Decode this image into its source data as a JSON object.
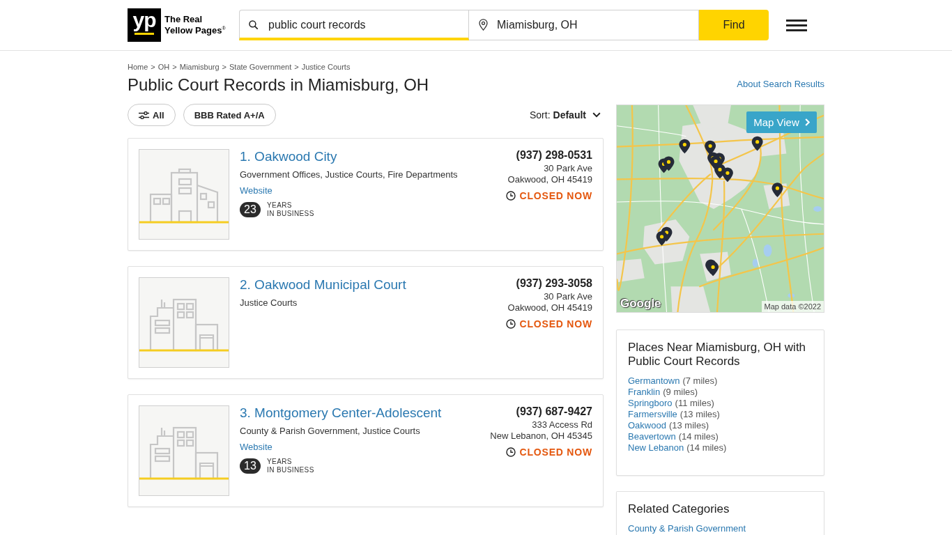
{
  "header": {
    "logo": {
      "mark": "yp",
      "name": "The Real Yellow Pages$^{®}$"
    },
    "search": {
      "value": "public court records"
    },
    "location": {
      "value": "Miamisburg, OH"
    },
    "find_button": "Find"
  },
  "breadcrumb": [
    {
      "label": "Home",
      "separator": ">"
    },
    {
      "label": "OH",
      "separator": ">"
    },
    {
      "label": "Miamisburg",
      "separator": ">"
    },
    {
      "label": "State Government",
      "separator": ">"
    },
    {
      "label": "Justice Courts"
    }
  ],
  "title": "Public Court Records in Miamisburg, OH",
  "about_link": "About Search Results",
  "filters": [
    {
      "label": "All",
      "kind": "menu"
    },
    {
      "label": "BBB Rated A+/A",
      "kind": "toggle"
    }
  ],
  "sort": {
    "label": "Sort:",
    "value": "Default"
  },
  "listings": [
    {
      "kind": "low-rise",
      "title": "1. Oakwood City",
      "categories": "Government Offices, Justice Courts, Fire Departments",
      "website": "Website",
      "years": "23",
      "years_label": [
        "YEARS",
        "IN BUSINESS"
      ],
      "phone": "(937) 298-0531",
      "address": [
        "30 Park Ave",
        "Oakwood, OH 45419"
      ],
      "status": "CLOSED NOW",
      "open": false
    },
    {
      "kind": "high-rise",
      "title": "2. Oakwood Municipal Court",
      "categories": "Justice Courts",
      "phone": "(937) 293-3058",
      "address": [
        "30 Park Ave",
        "Oakwood, OH 45419"
      ],
      "status": "CLOSED NOW",
      "open": false
    },
    {
      "kind": "high-rise",
      "title": "3. Montgomery Center-Adolescent",
      "categories": "County & Parish Government, Justice Courts",
      "website": "Website",
      "years": "13",
      "years_label": [
        "YEARS",
        "IN BUSINESS"
      ],
      "phone": "(937) 687-9427",
      "address": [
        "333 Access Rd",
        "New Lebanon, OH 45345"
      ],
      "status": "CLOSED NOW",
      "open": false
    }
  ],
  "map": {
    "button": "Map View",
    "logo": "Google",
    "attribution": "Map data ©2022"
  },
  "places_near": {
    "title": "Places Near Miamisburg, OH with Public Court Records",
    "items": [
      {
        "name": "Germantown",
        "distance": "(7 miles)"
      },
      {
        "name": "Franklin",
        "distance": "(9 miles)"
      },
      {
        "name": "Springboro",
        "distance": "(11 miles)"
      },
      {
        "name": "Farmersville",
        "distance": "(13 miles)"
      },
      {
        "name": "Oakwood",
        "distance": "(13 miles)"
      },
      {
        "name": "Beavertown",
        "distance": "(14 miles)"
      },
      {
        "name": "New Lebanon",
        "distance": "(14 miles)"
      }
    ]
  },
  "related_categories": {
    "title": "Related Categories",
    "items": [
      "County & Parish Government"
    ]
  }
}
